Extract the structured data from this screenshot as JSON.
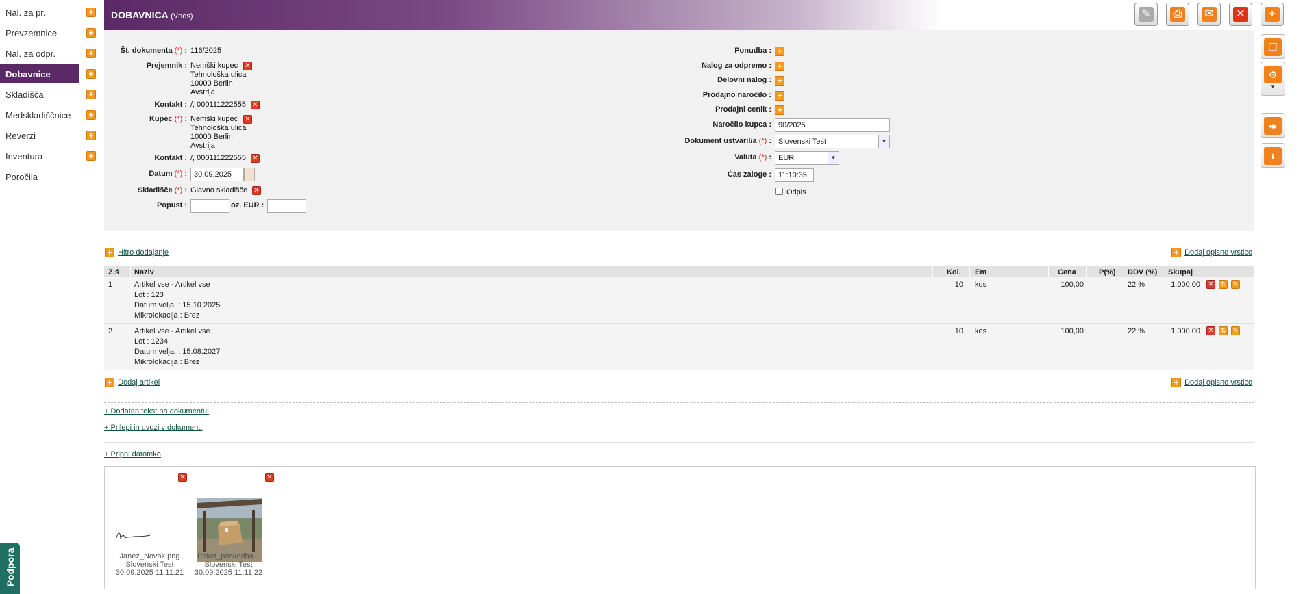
{
  "sidebar": {
    "items": [
      {
        "label": "Nal. za pr.",
        "has_plus": true,
        "active": false
      },
      {
        "label": "Prevzemnice",
        "has_plus": true,
        "active": false
      },
      {
        "label": "Nal. za odpr.",
        "has_plus": true,
        "active": false
      },
      {
        "label": "Dobavnice",
        "has_plus": true,
        "active": true
      },
      {
        "label": "Skladišča",
        "has_plus": true,
        "active": false
      },
      {
        "label": "Medskladiščnice",
        "has_plus": true,
        "active": false
      },
      {
        "label": "Reverzi",
        "has_plus": true,
        "active": false
      },
      {
        "label": "Inventura",
        "has_plus": true,
        "active": false
      },
      {
        "label": "Poročila",
        "has_plus": false,
        "active": false
      }
    ],
    "support_label": "Podpora"
  },
  "header": {
    "title": "DOBAVNICA",
    "subtitle": "(Vnos)",
    "toolbar_icons": [
      "edit-icon",
      "print-icon",
      "mail-icon",
      "close-icon",
      "add-icon"
    ]
  },
  "right_tools": [
    "copy-icon",
    "settings-icon",
    "split-icon",
    "info-icon"
  ],
  "form": {
    "required_mark": "(*)",
    "doc_number_label": "Št. dokumenta",
    "doc_number": "116/2025",
    "recipient_label": "Prejemnik :",
    "recipient": {
      "name": "Nemški kupec",
      "street": "Tehnološka ulica",
      "city": "10000 Berlin",
      "country": "Avstrija"
    },
    "contact_label": "Kontakt :",
    "contact_value": "/, 000111222555",
    "buyer_label": "Kupec",
    "buyer": {
      "name": "Nemški kupec",
      "street": "Tehnološka ulica",
      "city": "10000 Berlin",
      "country": "Avstrija"
    },
    "contact2_value": "/, 000111222555",
    "date_label": "Datum",
    "date_value": "30.09.2025",
    "warehouse_label": "Skladišče",
    "warehouse_value": "Glavno skladišče",
    "discount_label": "Popust :",
    "discount_value": "",
    "discount_eur_label": "oz. EUR :",
    "discount_eur_value": "",
    "offer_label": "Ponudba :",
    "dispatch_order_label": "Nalog za odpremo :",
    "work_order_label": "Delovni nalog :",
    "sales_order_label": "Prodajno naročilo :",
    "price_list_label": "Prodajni cenik :",
    "customer_order_label": "Naročilo kupca :",
    "customer_order_value": "90/2025",
    "created_by_label": "Dokument ustvaril/a",
    "created_by_value": "Slovenski Test",
    "currency_label": "Valuta",
    "currency_value": "EUR",
    "stock_time_label": "Čas zaloge :",
    "stock_time_value": "11:10:35",
    "writeoff_label": "Odpis"
  },
  "quick_add_label": "Hitro dodajanje",
  "add_desc_row_label": "Dodaj opisno vrstico",
  "table": {
    "headers": {
      "zs": "Z.š",
      "naziv": "Naziv",
      "kol": "Kol.",
      "em": "Em",
      "cena": "Cena",
      "p": "P(%)",
      "ddv": "DDV (%)",
      "skupaj": "Skupaj"
    },
    "rows": [
      {
        "zs": "1",
        "naziv": "Artikel vse - Artikel vse",
        "lot": "Lot : 123",
        "expiry": "Datum velja. : 15.10.2025",
        "microloc": "Mikrolokacija : Brez",
        "kol": "10",
        "em": "kos",
        "cena": "100,00",
        "p": "",
        "ddv": "22 %",
        "skupaj": "1.000,00"
      },
      {
        "zs": "2",
        "naziv": "Artikel vse - Artikel vse",
        "lot": "Lot : 1234",
        "expiry": "Datum velja. : 15.08.2027",
        "microloc": "Mikrolokacija : Brez",
        "kol": "10",
        "em": "kos",
        "cena": "100,00",
        "p": "",
        "ddv": "22 %",
        "skupaj": "1.000,00"
      }
    ]
  },
  "add_article_label": "Dodaj artikel",
  "add_desc_row_label2": "Dodaj opisno vrstico",
  "added_text_label": "+ Dodaten tekst na dokumentu:",
  "paste_import_label": "+ Prilepi in uvozi v dokument:",
  "attach_file_label": "+ Pripni datoteko",
  "attachments": [
    {
      "filename": "Janez_Novak.png",
      "user": "Slovenski Test",
      "time": "30.09.2025 11:11:21"
    },
    {
      "filename": "Paket_poskodba...",
      "user": "Slovenski Test",
      "time": "30.09.2025 11:11:22"
    }
  ],
  "colors": {
    "brand_purple": "#5b2a66",
    "accent_orange": "#f0811c",
    "delete_red": "#e0311c",
    "link_green": "#13544a"
  }
}
